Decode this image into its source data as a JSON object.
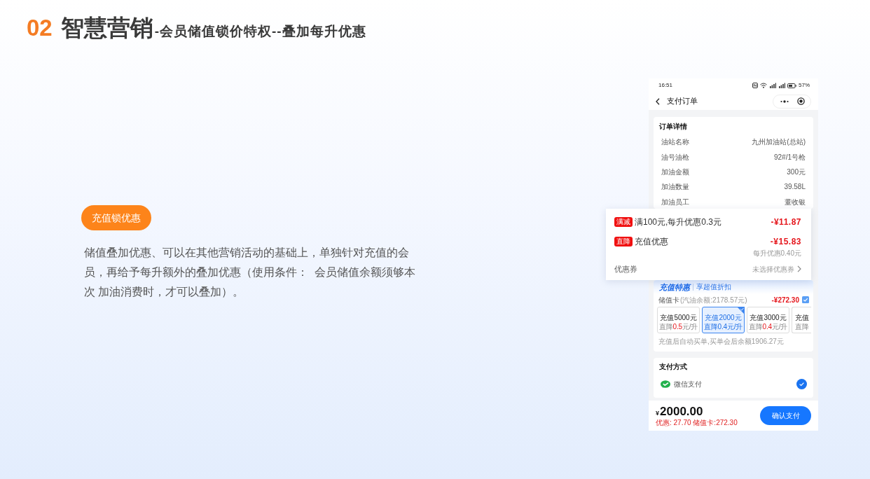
{
  "title": {
    "number": "02",
    "main": "智慧营销",
    "subtitle": "-会员储值锁价特权--叠加每升优惠"
  },
  "feature": {
    "tag": "充值锁优惠",
    "description": "储值叠加优惠、可以在其他营销活动的基础上，单独针对充值的会员，再给予每升额外的叠加优惠（使用条件：  会员储值余额须够本次 加油消费时，才可以叠加）。"
  },
  "phone": {
    "status_bar": {
      "time": "16:51",
      "battery": "57%"
    },
    "nav": {
      "title": "支付订单"
    },
    "order_details": {
      "title": "订单详情",
      "rows": [
        {
          "label": "油站名称",
          "value": "九州加油站(总站)"
        },
        {
          "label": "油号油枪",
          "value": "92#/1号枪"
        },
        {
          "label": "加油金额",
          "value": "300元"
        },
        {
          "label": "加油数量",
          "value": "39.58L"
        },
        {
          "label": "加油员工",
          "value": "董收银"
        }
      ]
    },
    "discounts": {
      "rows": [
        {
          "badge": "满减",
          "text": "满100元,每升优惠0.3元",
          "amount": "-¥11.87"
        },
        {
          "badge": "直降",
          "text": "充值优惠",
          "amount": "-¥15.83",
          "note": "每升优惠0.40元"
        }
      ],
      "coupon": {
        "label": "优惠券",
        "value": "未选择优惠券"
      }
    },
    "recharge": {
      "brand": "充值特惠",
      "slogan": "享超值折扣",
      "card_label": "储值卡",
      "card_balance": "(汽油余额:2178.57元)",
      "card_amount": "-¥272.30",
      "card_checked": true,
      "options": [
        {
          "label": "充值5000元",
          "prefix": "直降",
          "value": "0.5",
          "unit": "元/升",
          "selected": false
        },
        {
          "label": "充值2000元",
          "prefix": "直降",
          "value": "0.4",
          "unit": "元/升",
          "selected": true
        },
        {
          "label": "充值3000元",
          "prefix": "直降",
          "value": "0.4",
          "unit": "元/升",
          "selected": false
        },
        {
          "label": "充值",
          "prefix": "直降",
          "selected": false
        }
      ],
      "note": "充值后自动买单,买单会后余额1906.27元"
    },
    "payment": {
      "title": "支付方式",
      "methods": [
        {
          "name": "微信支付",
          "selected": true
        }
      ]
    },
    "footer": {
      "currency": "¥",
      "total": "2000.00",
      "summary": "优惠: 27.70 储值卡:272.30",
      "button": "确认支付"
    }
  }
}
